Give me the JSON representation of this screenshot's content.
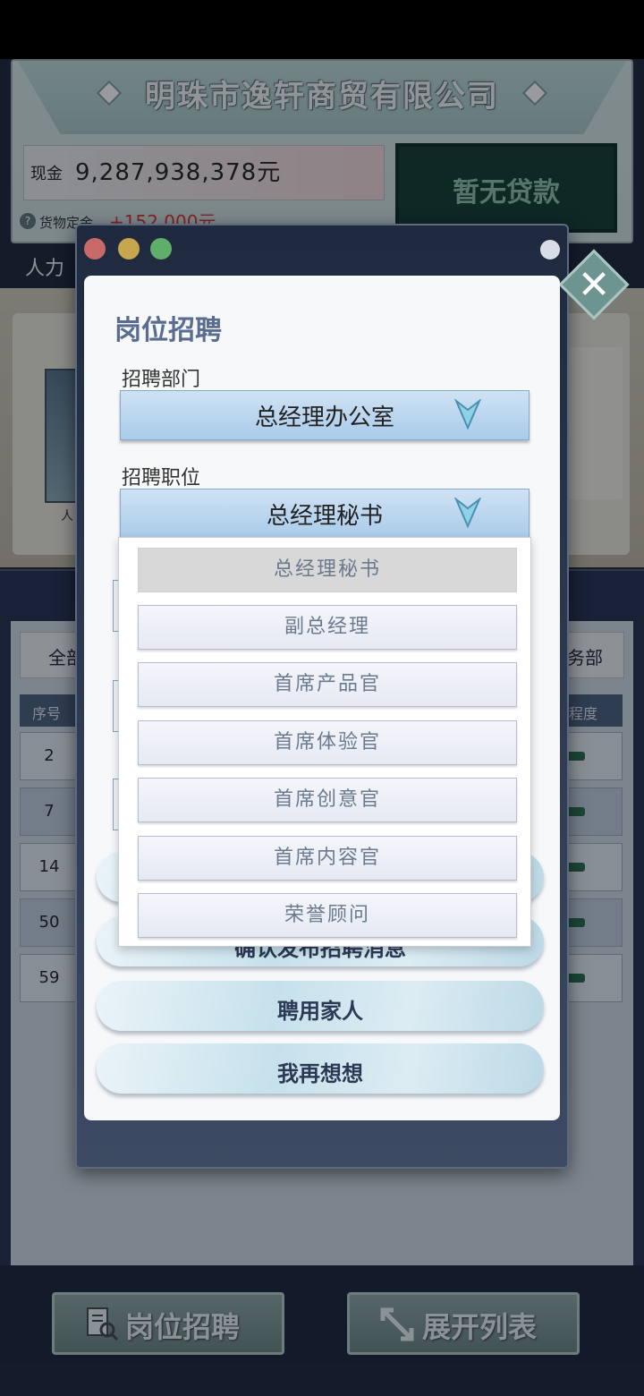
{
  "company": {
    "name": "明珠市逸轩商贸有限公司"
  },
  "finance": {
    "cash_label": "现金",
    "cash_value": "9,287,938,378元",
    "loan_label": "暂无贷款",
    "cargo_label": "货物定金",
    "cargo_value": "+152,000元"
  },
  "hr_tab": {
    "label": "人力"
  },
  "background": {
    "avatar_caption": "人",
    "filters": {
      "all": "全部",
      "dept": "务部"
    },
    "table_headers": {
      "seq": "序号",
      "degree": "程度"
    },
    "rows": [
      "2",
      "7",
      "14",
      "50",
      "59"
    ]
  },
  "dialog": {
    "title": "岗位招聘",
    "department": {
      "label": "招聘部门",
      "value": "总经理办公室"
    },
    "position": {
      "label": "招聘职位",
      "value": "总经理秘书"
    },
    "position_options": [
      "总经理秘书",
      "副总经理",
      "首席产品官",
      "首席体验官",
      "首席创意官",
      "首席内容官",
      "荣誉顾问"
    ],
    "buttons": {
      "post": "确认发布招聘消息",
      "hire_family": "聘用家人",
      "think_again": "我再想想"
    }
  },
  "bottom_bar": {
    "recruit": "岗位招聘",
    "expand": "展开列表"
  },
  "colors": {
    "accent": "#5a6d90",
    "select_bg": "#bcd6ee",
    "loan_bg": "#123c2e"
  }
}
